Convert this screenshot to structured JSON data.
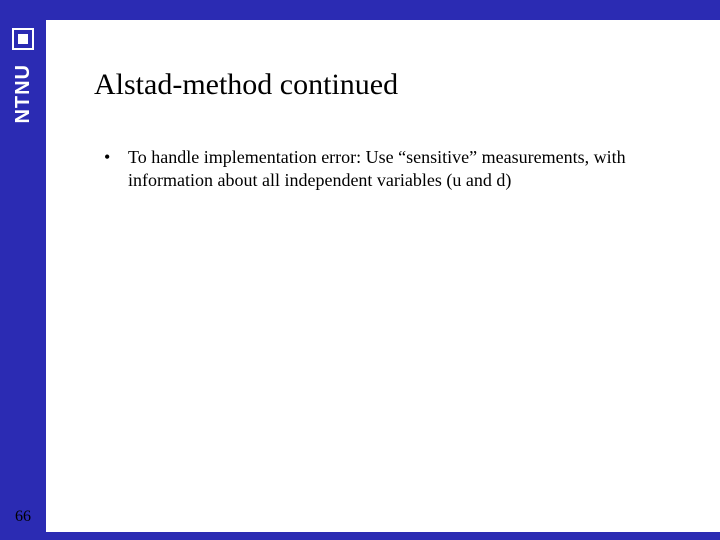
{
  "brand": {
    "name": "NTNU",
    "accent_color": "#2b2bb3"
  },
  "slide": {
    "title": "Alstad-method continued",
    "bullets": [
      "To handle implementation error: Use “sensitive” measurements, with information about all independent variables (u and d)"
    ],
    "page_number": "66"
  }
}
